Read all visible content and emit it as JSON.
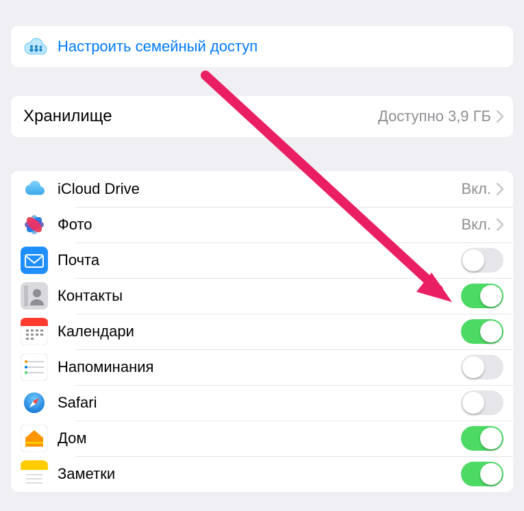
{
  "family": {
    "label": "Настроить семейный доступ"
  },
  "storage": {
    "label": "Хранилище",
    "value": "Доступно 3,9 ГБ"
  },
  "apps": [
    {
      "id": "icloud-drive",
      "label": "iCloud Drive",
      "control": "disclosure",
      "value": "Вкл."
    },
    {
      "id": "photos",
      "label": "Фото",
      "control": "disclosure",
      "value": "Вкл."
    },
    {
      "id": "mail",
      "label": "Почта",
      "control": "toggle",
      "on": false
    },
    {
      "id": "contacts",
      "label": "Контакты",
      "control": "toggle",
      "on": true
    },
    {
      "id": "calendars",
      "label": "Календари",
      "control": "toggle",
      "on": true
    },
    {
      "id": "reminders",
      "label": "Напоминания",
      "control": "toggle",
      "on": false
    },
    {
      "id": "safari",
      "label": "Safari",
      "control": "toggle",
      "on": false
    },
    {
      "id": "home",
      "label": "Дом",
      "control": "toggle",
      "on": true
    },
    {
      "id": "notes",
      "label": "Заметки",
      "control": "toggle",
      "on": true
    }
  ],
  "colors": {
    "accent": "#007aff",
    "toggle_on": "#4cd964",
    "arrow": "#e91e63"
  }
}
